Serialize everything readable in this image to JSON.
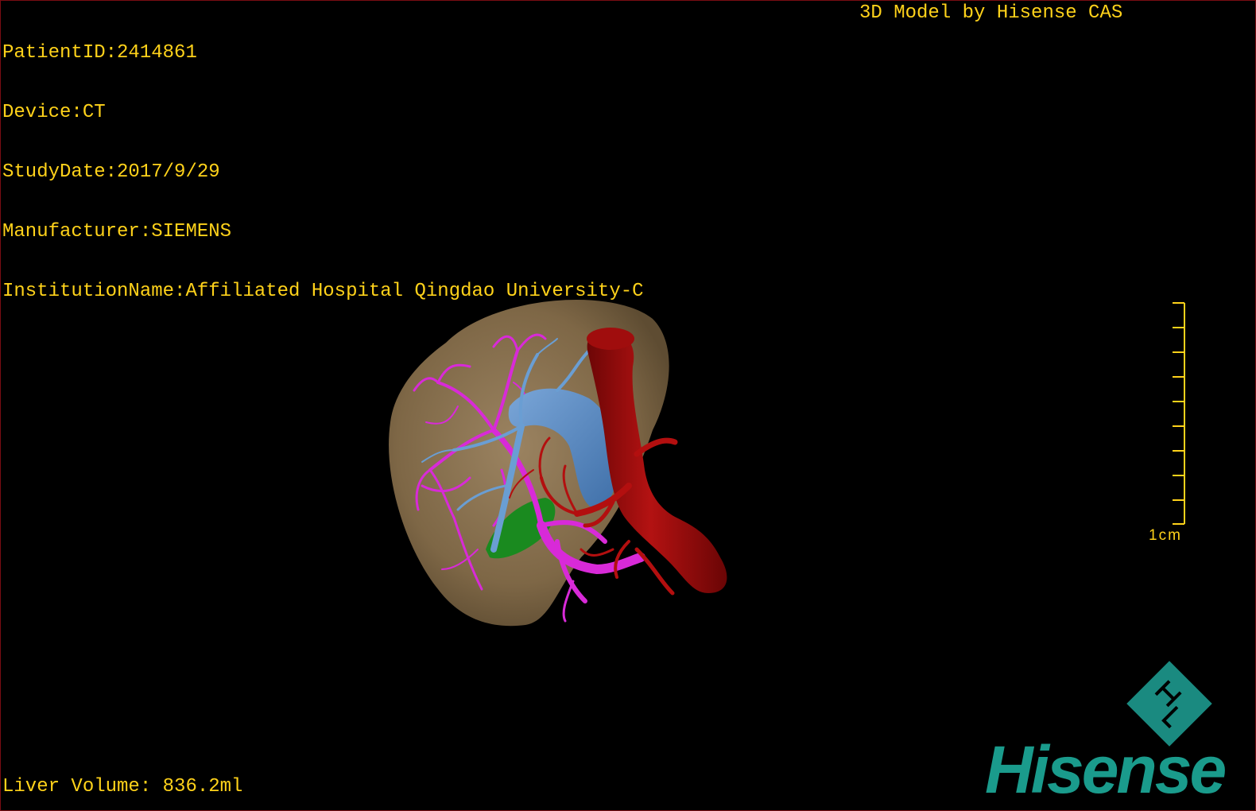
{
  "overlay": {
    "patient_id": "PatientID:2414861",
    "device": "Device:CT",
    "study_date": "StudyDate:2017/9/29",
    "manufacturer": "Manufacturer:SIEMENS",
    "institution": "InstitutionName:Affiliated Hospital Qingdao University-C",
    "model_credit": "3D Model by Hisense CAS",
    "liver_volume": "Liver Volume: 836.2ml"
  },
  "scale": {
    "label": "1cm"
  },
  "logo": {
    "brand": "Hisense",
    "icon": "hisense-diamond-logo-icon"
  },
  "colors": {
    "overlay_text": "#ffd21a",
    "liver": "#8a7352",
    "portal_vein": "#5b8fc9",
    "hepatic_veins": "#d82ad8",
    "vena_cava": "#9b0b0b",
    "gallbladder": "#1a8a1f",
    "brand": "#1a9b8c"
  }
}
